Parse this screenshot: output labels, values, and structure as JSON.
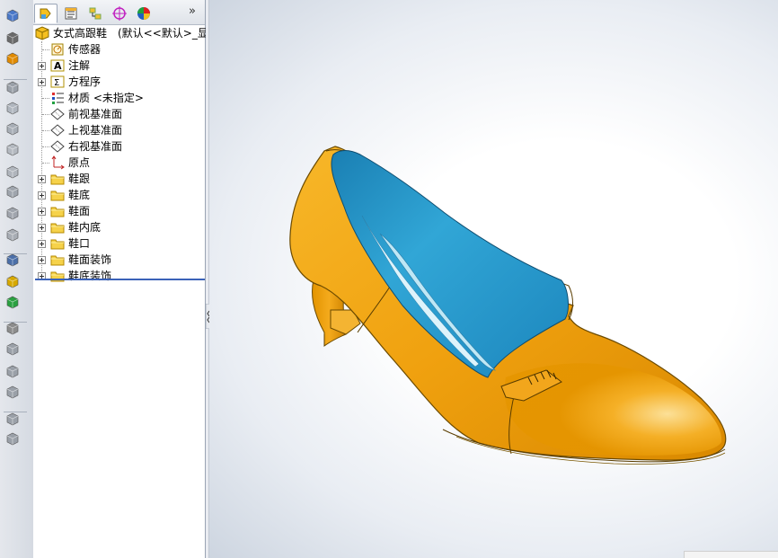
{
  "feature_manager": {
    "tabs": [
      {
        "name": "feature-tree-tab",
        "icon": "feature-tree-icon",
        "active": true
      },
      {
        "name": "property-manager-tab",
        "icon": "property-manager-icon"
      },
      {
        "name": "configuration-manager-tab",
        "icon": "configuration-manager-icon"
      },
      {
        "name": "dimxpert-tab",
        "icon": "dimxpert-icon"
      },
      {
        "name": "display-manager-tab",
        "icon": "display-manager-icon"
      }
    ],
    "more_tabs_label": "»",
    "root": "女式高跟鞋　(默认<<默认>_显示",
    "items": [
      {
        "label": "传感器",
        "icon": "sensor-icon",
        "expandable": false
      },
      {
        "label": "注解",
        "icon": "annotations-icon",
        "expandable": true
      },
      {
        "label": "方程序",
        "icon": "equations-icon",
        "expandable": true
      },
      {
        "label": "材质 <未指定>",
        "icon": "material-icon",
        "expandable": false
      },
      {
        "label": "前视基准面",
        "icon": "plane-icon",
        "expandable": false
      },
      {
        "label": "上视基准面",
        "icon": "plane-icon",
        "expandable": false
      },
      {
        "label": "右视基准面",
        "icon": "plane-icon",
        "expandable": false
      },
      {
        "label": "原点",
        "icon": "origin-icon",
        "expandable": false
      },
      {
        "label": "鞋跟",
        "icon": "folder-icon",
        "expandable": true
      },
      {
        "label": "鞋底",
        "icon": "folder-icon",
        "expandable": true
      },
      {
        "label": "鞋面",
        "icon": "folder-icon",
        "expandable": true
      },
      {
        "label": "鞋内底",
        "icon": "folder-icon",
        "expandable": true
      },
      {
        "label": "鞋口",
        "icon": "folder-icon",
        "expandable": true
      },
      {
        "label": "鞋面装饰",
        "icon": "folder-icon",
        "expandable": true
      },
      {
        "label": "鞋底装饰",
        "icon": "folder-icon",
        "expandable": true
      }
    ]
  },
  "command_bar": {
    "tools": [
      "extruded-boss-icon",
      "revolved-boss-icon",
      "swept-boss-icon",
      "extruded-cut-icon",
      "fillet-icon",
      "chamfer-icon",
      "rib-icon",
      "draft-icon",
      "shell-icon",
      "mirror-icon",
      "linear-pattern-icon",
      "rebuild-icon",
      "box-select-icon",
      "sphere-icon",
      "info-icon",
      "move-face-icon",
      "move-copy-icon",
      "combine-icon",
      "intersect-icon",
      "delete-icon",
      "appearance-icon",
      "section-view-icon"
    ]
  },
  "colors": {
    "shoe_upper": "#f0a10f",
    "shoe_lining": "#2a9ac8",
    "toolbar_bg": "#dde1e7",
    "selection": "#3b62b8"
  }
}
